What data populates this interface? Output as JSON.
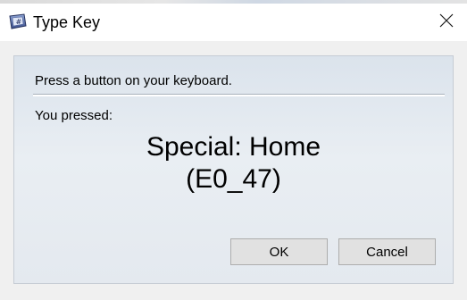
{
  "window": {
    "title": "Type Key",
    "icon": "keyboard-key-icon",
    "close_icon": "close-icon"
  },
  "dialog": {
    "prompt": "Press a button on your keyboard.",
    "pressed_label": "You pressed:",
    "key_name": "Special: Home",
    "key_code": "(E0_47)"
  },
  "buttons": {
    "ok_label": "OK",
    "cancel_label": "Cancel"
  },
  "colors": {
    "panel_gradient_top": "#dbe3ec",
    "panel_gradient_bottom": "#e4e9ef",
    "button_face": "#e1e1e1",
    "button_border": "#adadad"
  }
}
